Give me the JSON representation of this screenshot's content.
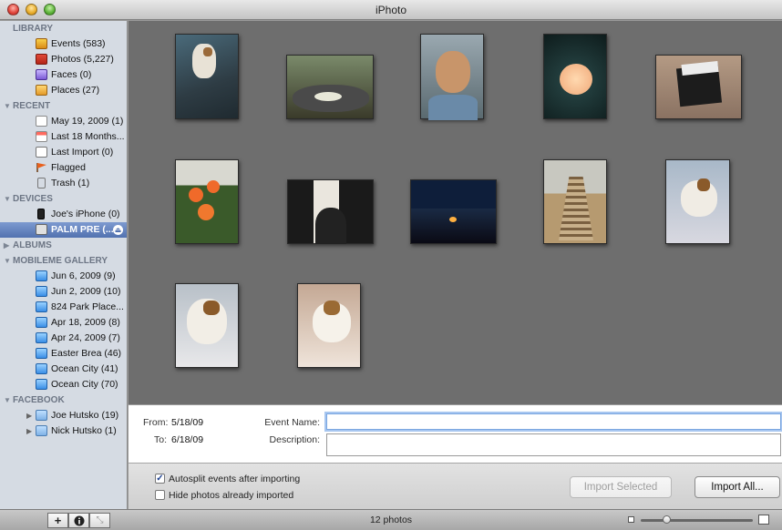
{
  "window": {
    "title": "iPhoto"
  },
  "sidebar": {
    "sections": {
      "library": "LIBRARY",
      "recent": "RECENT",
      "devices": "DEVICES",
      "albums": "ALBUMS",
      "mobileme": "MOBILEME GALLERY",
      "facebook": "FACEBOOK"
    },
    "library": [
      "Events (583)",
      "Photos (5,227)",
      "Faces (0)",
      "Places (27)"
    ],
    "recent": [
      "May 19, 2009 (1)",
      "Last 18 Months...",
      "Last Import (0)",
      "Flagged",
      "Trash (1)"
    ],
    "devices": [
      "Joe's iPhone (0)",
      "PALM PRE (..."
    ],
    "mobileme": [
      "Jun 6, 2009 (9)",
      "Jun 2, 2009 (10)",
      "824 Park Place...",
      "Apr 18, 2009 (8)",
      "Apr 24, 2009 (7)",
      "Easter Brea (46)",
      "Ocean City (41)",
      "Ocean City (70)"
    ],
    "facebook": [
      "Joe Hutsko (19)",
      "Nick Hutsko (1)"
    ]
  },
  "event": {
    "from_label": "From:",
    "from_value": "5/18/09",
    "to_label": "To:",
    "to_value": "6/18/09",
    "name_label": "Event Name:",
    "name_value": "",
    "description_label": "Description:",
    "description_value": ""
  },
  "import": {
    "autosplit_label": "Autosplit events after importing",
    "autosplit_checked": true,
    "hide_label": "Hide photos already imported",
    "hide_checked": false,
    "import_selected": "Import Selected",
    "import_all": "Import All..."
  },
  "status": {
    "count": "12 photos"
  },
  "colors": {
    "sidebar_bg": "#d5dbe3",
    "selection": "#5272b0",
    "browser_bg": "#6e6e6e"
  }
}
